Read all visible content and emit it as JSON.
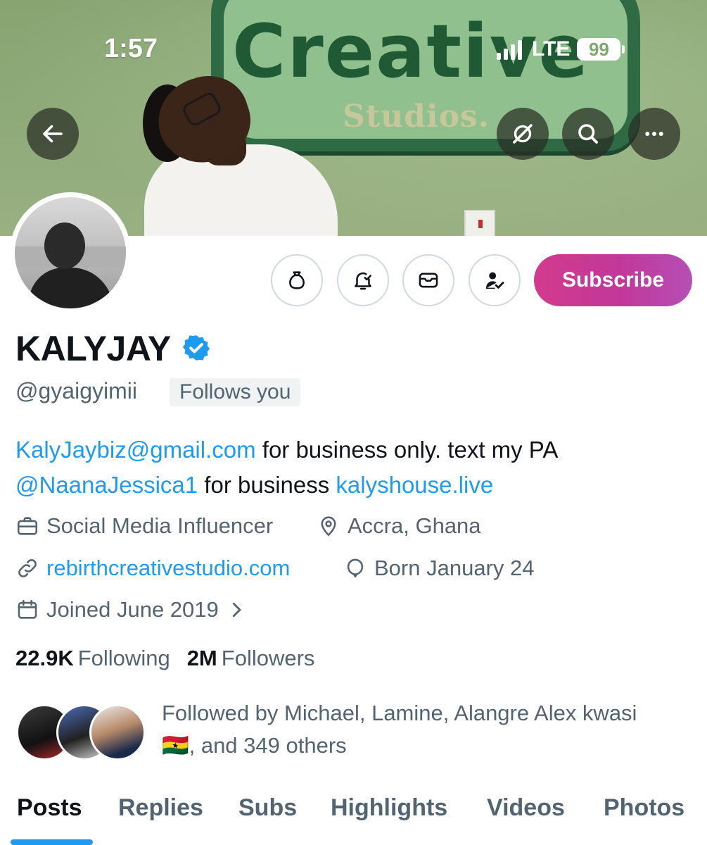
{
  "status_bar": {
    "time": "1:57",
    "network": "LTE",
    "battery": "99"
  },
  "banner": {
    "sign_title": "Creative",
    "sign_subtitle": "Studios."
  },
  "header_actions": {
    "back_icon": "arrow-left-icon",
    "grok_icon": "grok-icon",
    "search_icon": "search-icon",
    "more_icon": "more-horizontal-icon"
  },
  "actions": {
    "tip_icon": "money-bag-icon",
    "notify_icon": "bell-check-icon",
    "message_icon": "envelope-icon",
    "follow_icon": "person-check-icon",
    "subscribe_label": "Subscribe"
  },
  "profile": {
    "name": "KALYJAY",
    "handle": "@gyaigyimii",
    "follows_you": "Follows you",
    "bio": {
      "email": "KalyJaybiz@gmail.com",
      "text1": " for business only. text my PA ",
      "mention": "@NaanaJessica1",
      "text2": " for business ",
      "site": "kalyshouse.live"
    },
    "category": "Social Media Influencer",
    "location": "Accra, Ghana",
    "website": "rebirthcreativestudio.com",
    "birthday": "Born January 24",
    "joined": "Joined June 2019"
  },
  "counts": {
    "following_value": "22.9K",
    "following_label": "Following",
    "followers_value": "2M",
    "followers_label": "Followers"
  },
  "followed_by": {
    "line1": "Followed by Michael, Lamine, Alangre Alex kwasi",
    "line2": "🇬🇭, and 349 others"
  },
  "tabs": [
    {
      "label": "Posts",
      "active": true
    },
    {
      "label": "Replies",
      "active": false
    },
    {
      "label": "Subs",
      "active": false
    },
    {
      "label": "Highlights",
      "active": false
    },
    {
      "label": "Videos",
      "active": false
    },
    {
      "label": "Photos",
      "active": false
    }
  ],
  "colors": {
    "accent": "#1d9bf0",
    "secondary_text": "#536471",
    "subscribe_gradient_start": "#d33a8c",
    "subscribe_gradient_end": "#b64fb4"
  }
}
